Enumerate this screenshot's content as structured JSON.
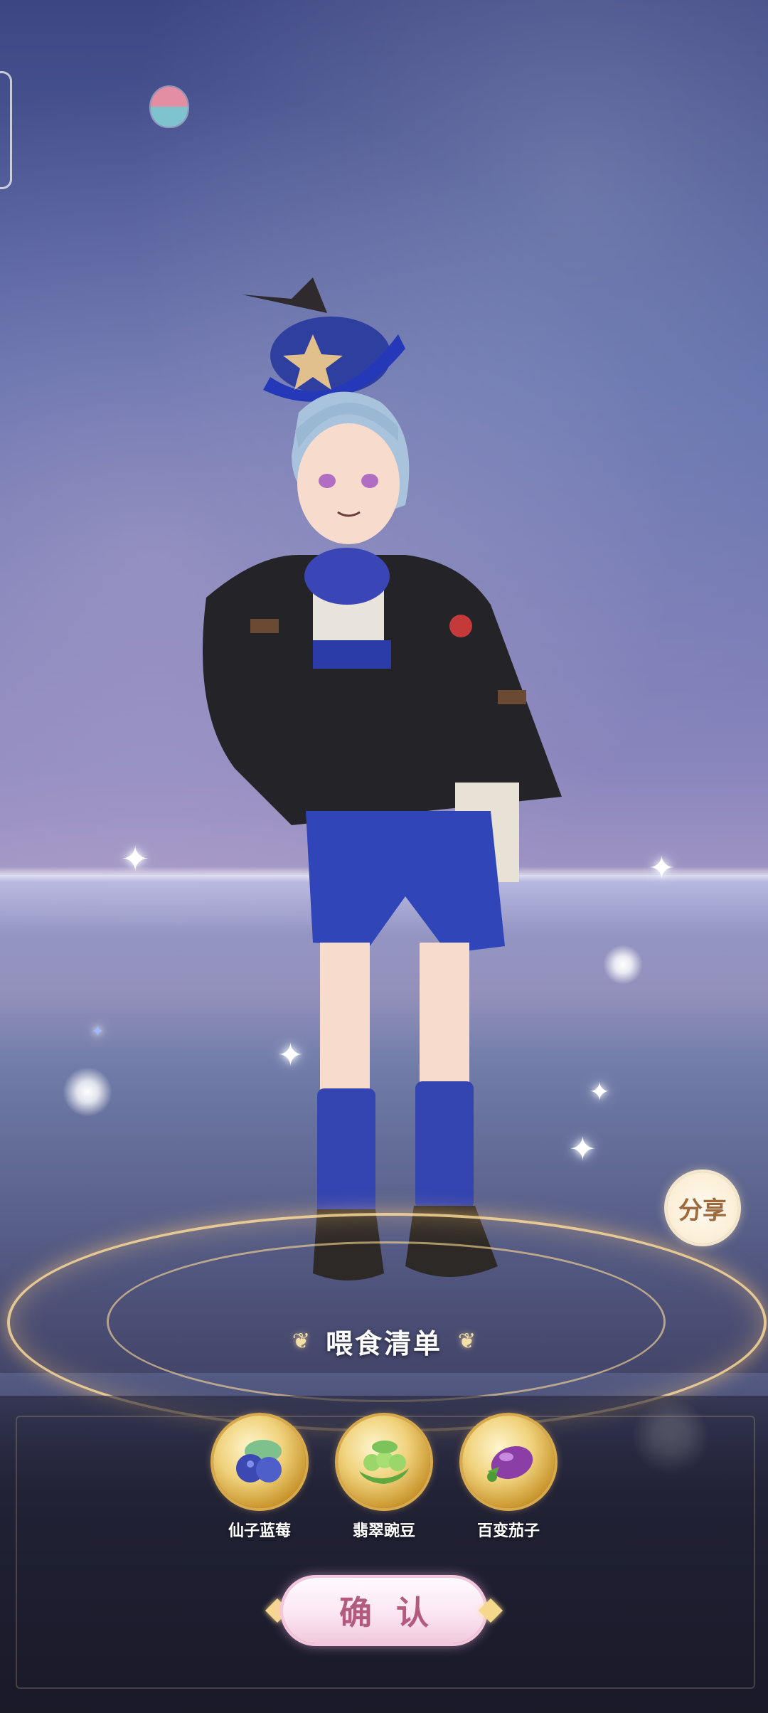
{
  "share": {
    "label": "分享"
  },
  "feeding_list": {
    "title": "喂食清单",
    "items": [
      {
        "name": "仙子蓝莓",
        "icon": "blueberry-icon"
      },
      {
        "name": "翡翠豌豆",
        "icon": "pea-icon"
      },
      {
        "name": "百变茄子",
        "icon": "eggplant-icon"
      }
    ]
  },
  "confirm": {
    "label": "确认"
  },
  "colors": {
    "sky_top": "#3c4683",
    "gold_accent": "#d9aa4b",
    "confirm_text": "#b25b7d",
    "share_text": "#9c6a3c"
  }
}
